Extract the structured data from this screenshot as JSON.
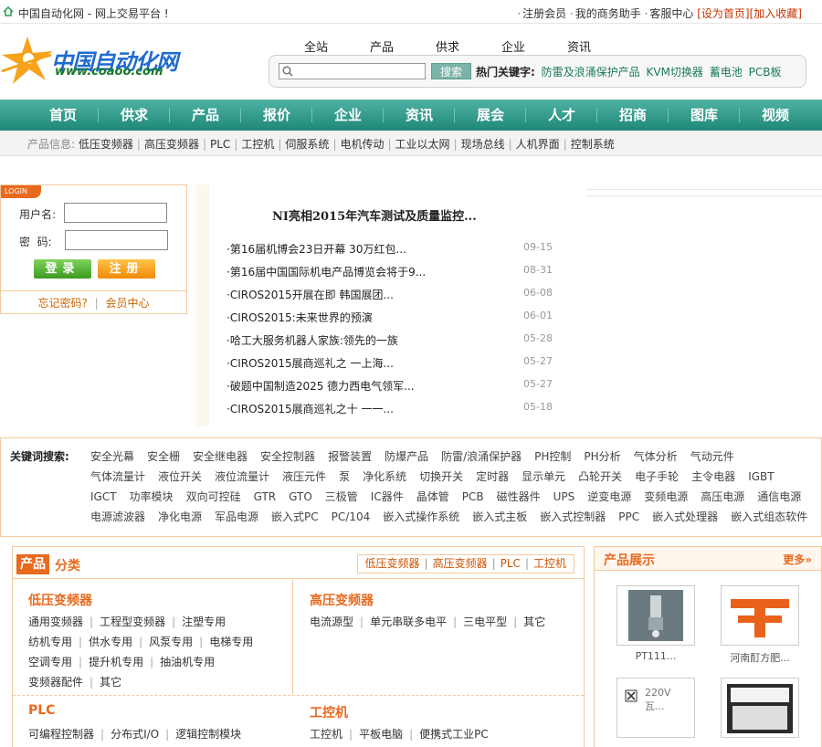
{
  "topbar": {
    "site_name": "中国自动化网 - 网上交易平台 !",
    "links": [
      "注册会员",
      "我的商务助手",
      "客服中心"
    ],
    "set_home": "[设为首页]",
    "add_fav": "[加入收藏]"
  },
  "logo": {
    "text": "中国自动化网",
    "url": "www.coaoo.com"
  },
  "search": {
    "tabs": [
      "全站",
      "产品",
      "供求",
      "企业",
      "资讯"
    ],
    "placeholder": "",
    "button": "搜索",
    "hot_label": "热门关键字:",
    "hot_keywords": [
      "防雷及浪涌保护产品",
      "KVM切换器",
      "蓄电池",
      "PCB板"
    ]
  },
  "nav": [
    "首页",
    "供求",
    "产品",
    "报价",
    "企业",
    "资讯",
    "展会",
    "人才",
    "招商",
    "图库",
    "视频"
  ],
  "subnav": {
    "label": "产品信息:",
    "items": [
      "低压变频器",
      "高压变频器",
      "PLC",
      "工控机",
      "伺服系统",
      "电机传动",
      "工业以太网",
      "现场总线",
      "人机界面",
      "控制系统"
    ]
  },
  "login": {
    "badge": "LOGIN",
    "username_label": "用户名:",
    "password_label": "密  码:",
    "login_btn": "登录",
    "register_btn": "注册",
    "forgot": "忘记密码?",
    "member_center": "会员中心"
  },
  "news": {
    "headline": "NI亮相2015年汽车测试及质量监控...",
    "items": [
      {
        "title": "第16届机博会23日开幕 30万红包...",
        "date": "09-15"
      },
      {
        "title": "第16届中国国际机电产品博览会将于9...",
        "date": "08-31"
      },
      {
        "title": "CIROS2015开展在即 韩国展团...",
        "date": "06-08"
      },
      {
        "title": "CIROS2015:未来世界的预演",
        "date": "06-01"
      },
      {
        "title": "哈工大服务机器人家族:领先的一族",
        "date": "05-28"
      },
      {
        "title": "CIROS2015展商巡礼之 一上海...",
        "date": "05-27"
      },
      {
        "title": "破题中国制造2025 德力西电气领军...",
        "date": "05-27"
      },
      {
        "title": "CIROS2015展商巡礼之十 一一...",
        "date": "05-18"
      }
    ]
  },
  "keywords": {
    "label": "关键词搜索:",
    "lines": [
      [
        "安全光幕",
        "安全栅",
        "安全继电器",
        "安全控制器",
        "报警装置",
        "防爆产品",
        "防雷/浪涌保护器",
        "PH控制",
        "PH分析",
        "气体分析",
        "气动元件"
      ],
      [
        "气体流量计",
        "液位开关",
        "液位流量计",
        "液压元件",
        "泵",
        "净化系统",
        "切换开关",
        "定时器",
        "显示单元",
        "凸轮开关",
        "电子手轮",
        "主令电器",
        "IGBT"
      ],
      [
        "IGCT",
        "功率模块",
        "双向可控硅",
        "GTR",
        "GTO",
        "三极管",
        "IC器件",
        "晶体管",
        "PCB",
        "磁性器件",
        "UPS",
        "逆变电源",
        "变频电源",
        "高压电源",
        "通信电源"
      ],
      [
        "电源滤波器",
        "净化电源",
        "军品电源",
        "嵌入式PC",
        "PC/104",
        "嵌入式操作系统",
        "嵌入式主板",
        "嵌入式控制器",
        "PPC",
        "嵌入式处理器",
        "嵌入式组态软件"
      ]
    ]
  },
  "category": {
    "title_a": "产品",
    "title_b": "分类",
    "tabs": [
      "低压变频器",
      "高压变频器",
      "PLC",
      "工控机"
    ],
    "groups": [
      {
        "title": "低压变频器",
        "rows": [
          [
            "通用变频器",
            "工程型变频器",
            "注塑专用"
          ],
          [
            "纺机专用",
            "供水专用",
            "风泵专用",
            "电梯专用"
          ],
          [
            "空调专用",
            "提升机专用",
            "抽油机专用"
          ],
          [
            "变频器配件",
            "其它"
          ]
        ]
      },
      {
        "title": "高压变频器",
        "rows": [
          [
            "电流源型",
            "单元串联多电平",
            "三电平型",
            "其它"
          ]
        ]
      },
      {
        "title": "PLC",
        "rows": [
          [
            "可编程控制器",
            "分布式I/O",
            "逻辑控制模块"
          ]
        ]
      },
      {
        "title": "工控机",
        "rows": [
          [
            "工控机",
            "平板电脑",
            "便携式工业PC"
          ]
        ]
      }
    ]
  },
  "products": {
    "title": "产品展示",
    "more": "更多»",
    "items": [
      {
        "caption": "PT111..."
      },
      {
        "caption": "河南酊方肥..."
      },
      {
        "caption": "220V 瓦...",
        "alt": "220V 瓦..."
      },
      {
        "caption": ""
      }
    ]
  },
  "colors": {
    "accent": "#e86a1f",
    "nav_green": "#2a9686",
    "border": "#f1c9a0"
  }
}
